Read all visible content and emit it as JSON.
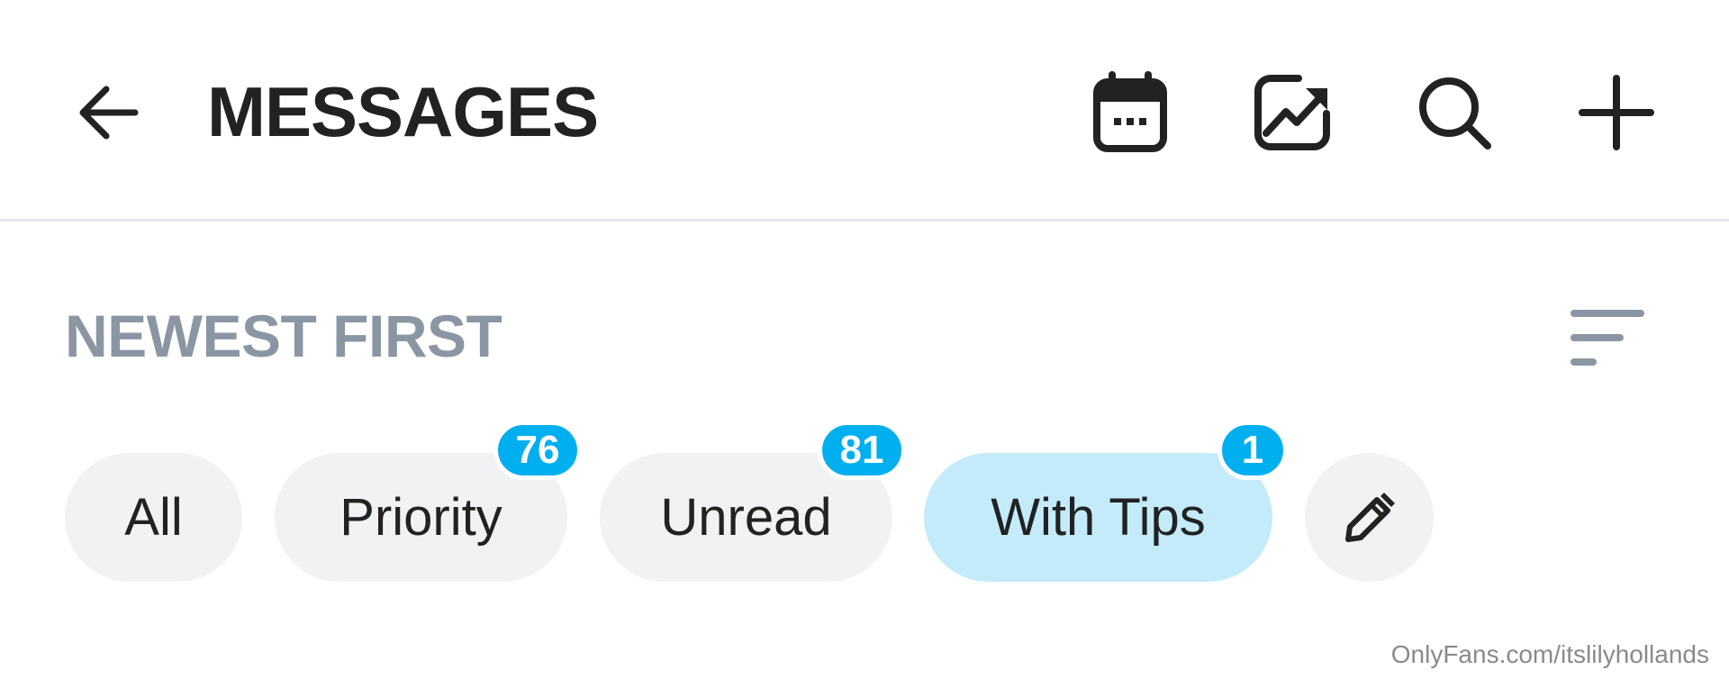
{
  "header": {
    "title": "MESSAGES",
    "icons": {
      "back": "arrow-left-icon",
      "calendar": "calendar-icon",
      "stats": "chart-trending-icon",
      "search": "search-icon",
      "add": "plus-icon"
    }
  },
  "sort": {
    "label": "NEWEST FIRST",
    "icon": "sort-lines-icon"
  },
  "filters": [
    {
      "label": "All",
      "badge": null,
      "active": false
    },
    {
      "label": "Priority",
      "badge": "76",
      "active": false
    },
    {
      "label": "Unread",
      "badge": "81",
      "active": false
    },
    {
      "label": "With Tips",
      "badge": "1",
      "active": true
    }
  ],
  "edit_filters_icon": "pencil-icon",
  "watermark": "OnlyFans.com/itslilyhollands",
  "colors": {
    "accent": "#00aff0",
    "active_chip": "#c3ebfa",
    "chip": "#f0f2f4",
    "muted_text": "#8a96a3"
  }
}
